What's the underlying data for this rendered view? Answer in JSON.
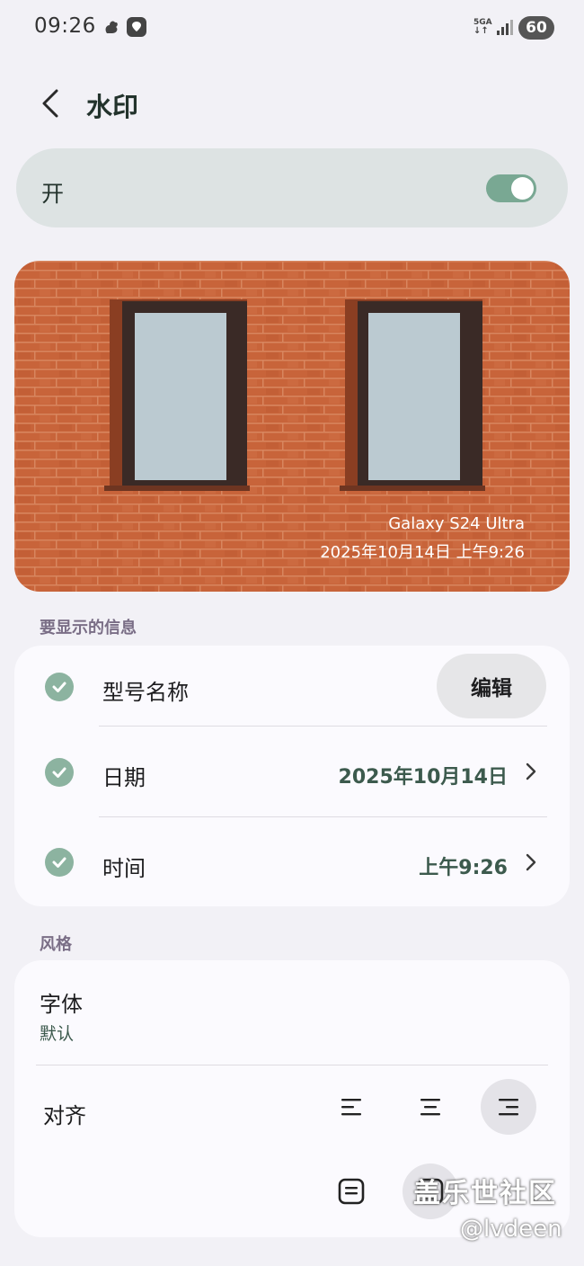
{
  "status_bar": {
    "time": "09:26",
    "network": "5GA",
    "battery": "60",
    "icons": [
      "squirrel-app-icon",
      "shield-app-icon",
      "signal-icon"
    ]
  },
  "header": {
    "title": "水印",
    "back_icon": "chevron-left-icon"
  },
  "master_toggle": {
    "label": "开",
    "on": true,
    "accent": "#79a893"
  },
  "preview": {
    "model_text": "Galaxy S24 Ultra",
    "date_text": "2025年10月14日 上午9:26"
  },
  "info_section": {
    "title": "要显示的信息",
    "edit_label": "编辑",
    "rows": [
      {
        "label": "型号名称",
        "checked": true,
        "value": ""
      },
      {
        "label": "日期",
        "checked": true,
        "value": "2025年10月14日"
      },
      {
        "label": "时间",
        "checked": true,
        "value": "上午9:26"
      }
    ]
  },
  "style_section": {
    "title": "风格",
    "font_label": "字体",
    "font_value": "默认",
    "align_label": "对齐",
    "align_options": [
      "align-left-icon",
      "align-center-icon",
      "align-right-icon"
    ],
    "align_selected": "align-right-icon",
    "position_options": [
      "box-bottom-icon",
      "box-top-icon"
    ]
  },
  "overlay": {
    "forum_name": "盖乐世社区",
    "handle": "@lvdeen"
  }
}
